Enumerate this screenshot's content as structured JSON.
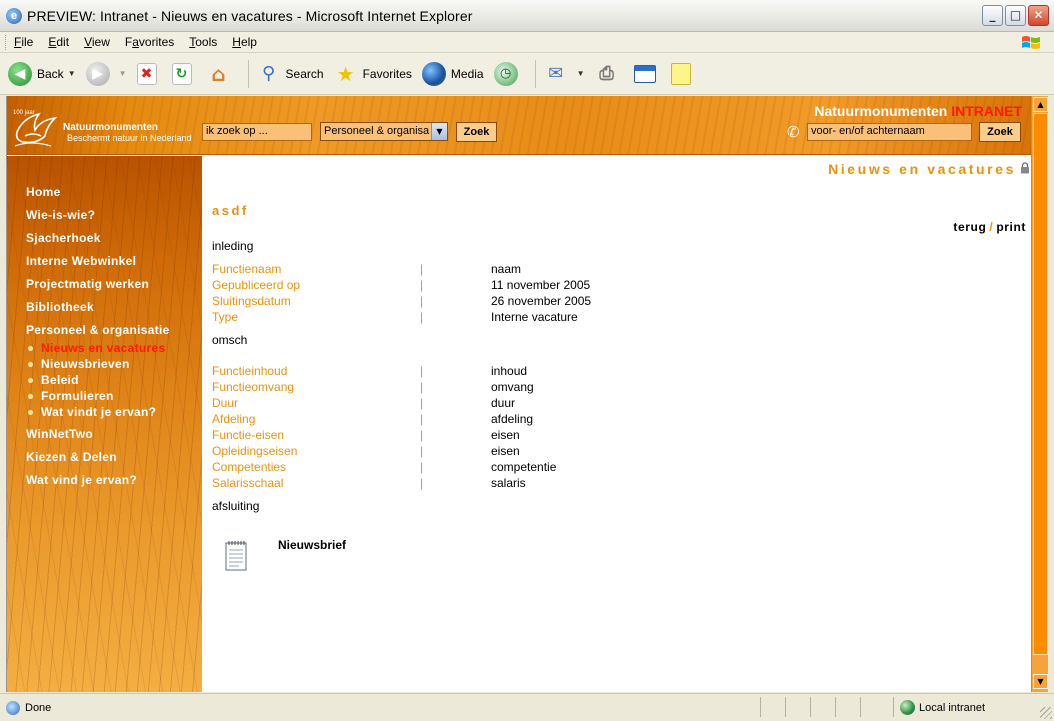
{
  "window": {
    "title": "PREVIEW: Intranet - Nieuws en vacatures - Microsoft Internet Explorer",
    "minimize": "_",
    "maximize": "□",
    "close": "✕"
  },
  "menu": {
    "items": [
      {
        "label": "File",
        "accel": "F",
        "rest": "ile"
      },
      {
        "label": "Edit",
        "accel": "E",
        "rest": "dit"
      },
      {
        "label": "View",
        "accel": "V",
        "rest": "iew"
      },
      {
        "label": "Favorites",
        "accel": "F",
        "rest": "avorites",
        "pre": "",
        "accel_index": 1
      },
      {
        "label": "Tools",
        "accel": "T",
        "rest": "ools"
      },
      {
        "label": "Help",
        "accel": "H",
        "rest": "elp"
      }
    ]
  },
  "toolbar": {
    "back": "Back",
    "search": "Search",
    "favorites": "Favorites",
    "media": "Media"
  },
  "header": {
    "logo_year": "100 jaar",
    "logo_title": "Natuurmonumenten",
    "logo_subtitle": "Beschermt natuur in Nederland",
    "search_value": "ik zoek op ...",
    "search_scope": "Personeel & organisa",
    "search_button": "Zoek",
    "brand_name": "Natuurmonumenten",
    "brand_suffix": "INTRANET",
    "people_search_value": "voor- en/of achternaam",
    "people_search_button": "Zoek"
  },
  "sidebar": {
    "items_top": [
      "Home",
      "Wie-is-wie?",
      "Sjacherhoek",
      "Interne Webwinkel",
      "Projectmatig werken",
      "Bibliotheek",
      "Personeel & organisatie"
    ],
    "sub_items": [
      "Nieuws en vacatures",
      "Nieuwsbrieven",
      "Beleid",
      "Formulieren",
      "Wat vindt je ervan?"
    ],
    "active_sub": "Nieuws en vacatures",
    "items_bottom": [
      "WinNetTwo",
      "Kiezen & Delen",
      "Wat vind je ervan?"
    ]
  },
  "content": {
    "page_heading": "Nieuws en vacatures",
    "item_title": "asdf",
    "back_link": "terug",
    "link_separator": "/",
    "print_link": "print",
    "intro": "inleding",
    "fields_top": [
      {
        "label": "Functienaam",
        "sep": "|",
        "value": "naam"
      },
      {
        "label": "Gepubliceerd op",
        "sep": "|",
        "value": "11 november 2005"
      },
      {
        "label": "Sluitingsdatum",
        "sep": "|",
        "value": "26 november 2005"
      },
      {
        "label": "Type",
        "sep": "|",
        "value": "Interne vacature"
      }
    ],
    "description": "omsch",
    "fields_bottom": [
      {
        "label": "Functieinhoud",
        "sep": "|",
        "value": "inhoud"
      },
      {
        "label": "Functieomvang",
        "sep": "|",
        "value": "omvang"
      },
      {
        "label": "Duur",
        "sep": "|",
        "value": "duur"
      },
      {
        "label": "Afdeling",
        "sep": "|",
        "value": "afdeling"
      },
      {
        "label": "Functie-eisen",
        "sep": "|",
        "value": "eisen"
      },
      {
        "label": "Opleidingseisen",
        "sep": "|",
        "value": "eisen"
      },
      {
        "label": "Competenties",
        "sep": "|",
        "value": "competentie"
      },
      {
        "label": "Salarisschaal",
        "sep": "|",
        "value": "salaris"
      }
    ],
    "closing": "afsluiting",
    "attachment_label": "Nieuwsbrief"
  },
  "status": {
    "left": "Done",
    "zone": "Local intranet"
  },
  "colors": {
    "accent_orange": "#e8920f",
    "header_orange": "#ee9a25",
    "active_red": "#ff1b00"
  }
}
